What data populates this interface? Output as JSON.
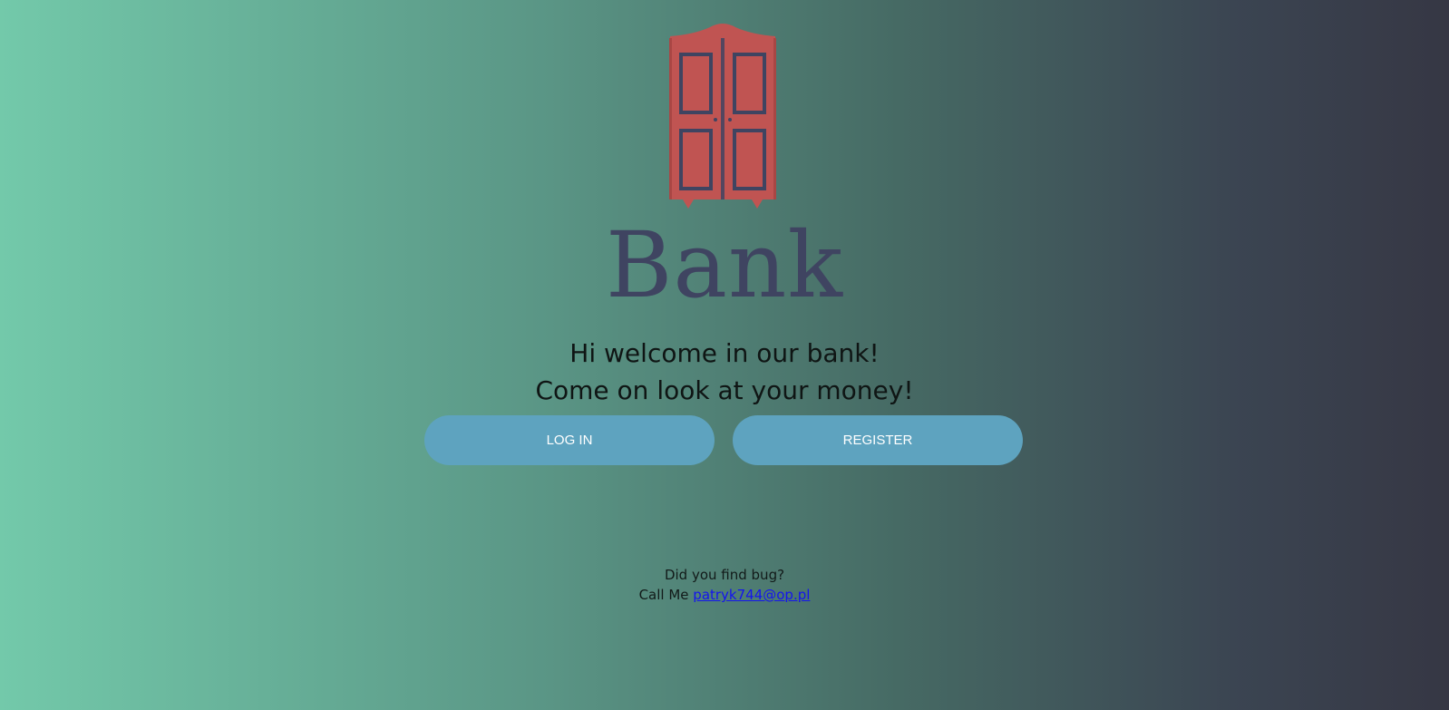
{
  "logo": {
    "icon": "wardrobe-icon",
    "color": "#c05452",
    "accent": "#3f4461"
  },
  "brand": {
    "title": "Bank"
  },
  "welcome": {
    "line1": "Hi welcome in our bank!",
    "line2": "Come on look at your money!"
  },
  "buttons": {
    "login_label": "LOG IN",
    "register_label": "REGISTER",
    "color": "#5ea3bf"
  },
  "footer": {
    "question": "Did you find bug?",
    "call_prefix": "Call Me ",
    "email": "patryk744@op.pl"
  }
}
